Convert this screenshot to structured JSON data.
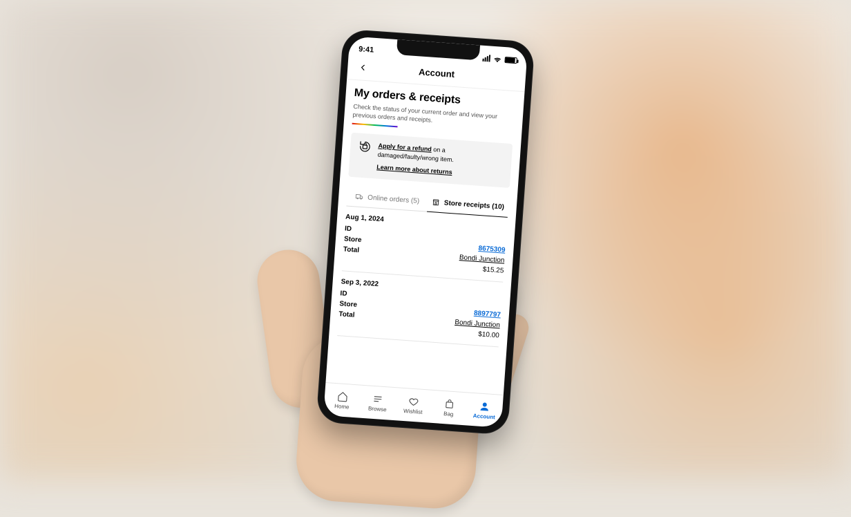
{
  "status": {
    "time": "9:41"
  },
  "nav": {
    "title": "Account"
  },
  "page": {
    "title": "My orders & receipts",
    "subtitle": "Check the status of your current order and view your previous orders and receipts."
  },
  "refund": {
    "lead": "Apply for a refund",
    "tail": " on a damaged/faulty/wrong item.",
    "learn": "Learn more about returns"
  },
  "tabs": {
    "online": "Online orders (5)",
    "store": "Store receipts (10)"
  },
  "labels": {
    "id": "ID",
    "store": "Store",
    "total": "Total"
  },
  "receipts": [
    {
      "date": "Aug 1, 2024",
      "id": "8675309",
      "store": "Bondi Junction",
      "total": "$15.25"
    },
    {
      "date": "Sep 3, 2022",
      "id": "8897797",
      "store": "Bondi Junction",
      "total": "$10.00"
    }
  ],
  "tabbar": {
    "home": "Home",
    "browse": "Browse",
    "wishlist": "Wishlist",
    "bag": "Bag",
    "account": "Account"
  }
}
